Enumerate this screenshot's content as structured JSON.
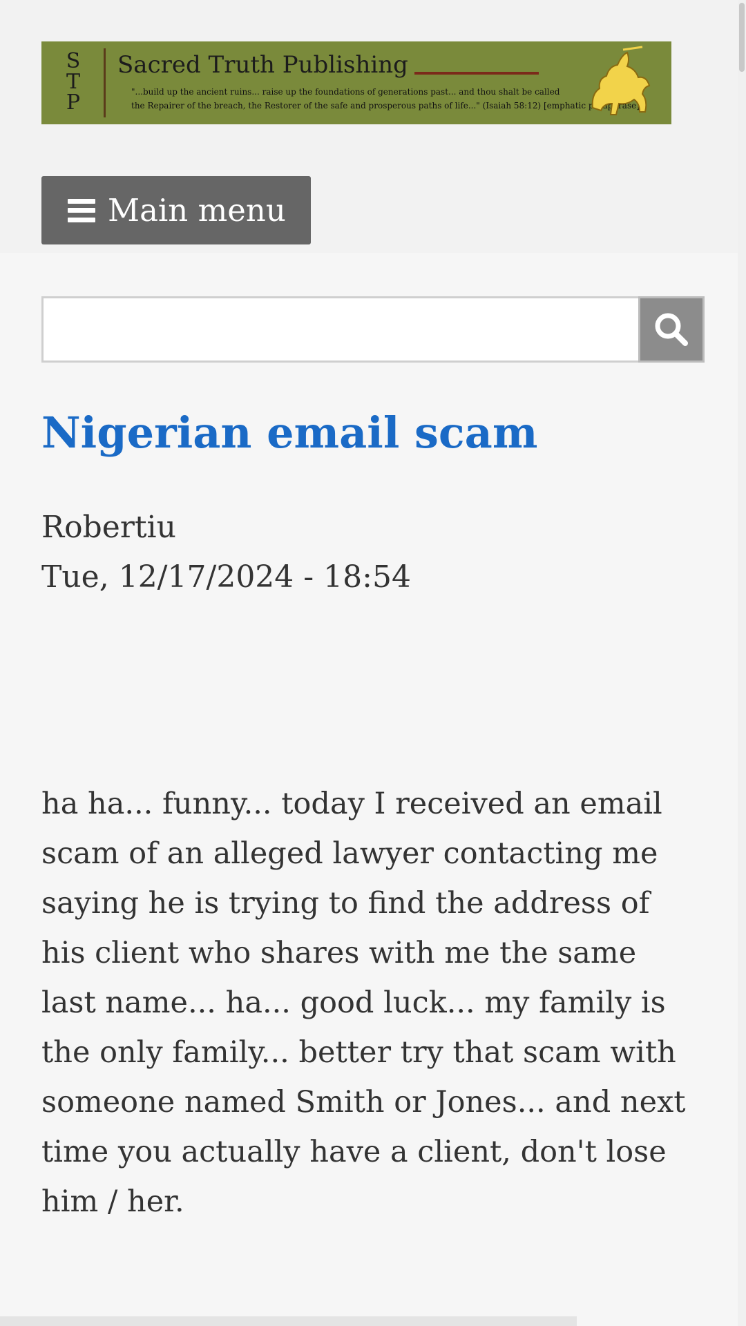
{
  "banner": {
    "logo_letters": "S T P",
    "title": "Sacred Truth Publishing",
    "quote_line1": "\"...build up the ancient ruins... raise up the foundations of generations past... and thou shalt be called",
    "quote_line2": "the Repairer of the breach, the Restorer of the safe and prosperous paths of life...\" (Isaiah 58:12) [emphatic paraphrase]",
    "colors": {
      "background": "#7a8a3b",
      "knight": "#f2d34a"
    }
  },
  "nav": {
    "menu_label": "Main menu",
    "menu_icon": "hamburger-icon"
  },
  "search": {
    "value": "",
    "icon": "search-icon"
  },
  "article": {
    "title": "Nigerian email scam",
    "author": "Robertiu",
    "date": "Tue, 12/17/2024 - 18:54",
    "body": "ha ha... funny... today I received an email scam of an alleged lawyer contacting me saying he is trying to find the address of his client who shares with me the same last name... ha... good luck... my family is the only family... better try that scam with someone named Smith or Jones... and next time you actually have a client, don't lose him / her."
  },
  "colors": {
    "title_link": "#1a6ac6",
    "menu_button": "#666666",
    "search_button": "#8c8c8c",
    "page_background": "#f6f6f6"
  }
}
